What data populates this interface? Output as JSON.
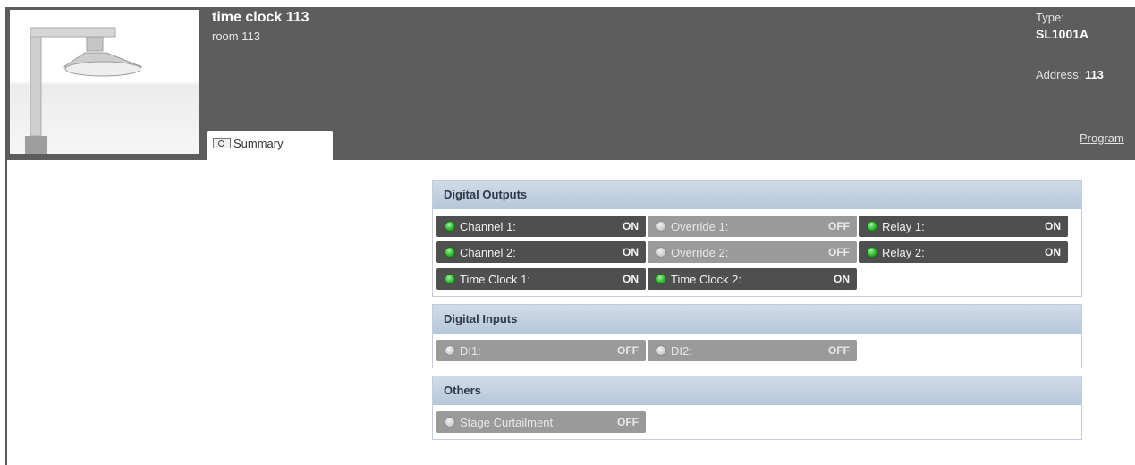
{
  "device": {
    "name": "time clock 113",
    "room": "room 113",
    "type_label": "Type:",
    "type_value": "SL1001A",
    "address_label": "Address:",
    "address_value": "113"
  },
  "tabs": [
    {
      "label": "Summary",
      "icon": "summary-icon"
    }
  ],
  "links": {
    "program": "Program"
  },
  "sections": {
    "digital_outputs": {
      "title": "Digital Outputs",
      "items": [
        {
          "label": "Channel 1:",
          "value": "ON",
          "state": "on"
        },
        {
          "label": "Override 1:",
          "value": "OFF",
          "state": "off"
        },
        {
          "label": "Relay 1:",
          "value": "ON",
          "state": "on"
        },
        {
          "label": "Channel 2:",
          "value": "ON",
          "state": "on"
        },
        {
          "label": "Override 2:",
          "value": "OFF",
          "state": "off"
        },
        {
          "label": "Relay 2:",
          "value": "ON",
          "state": "on"
        },
        {
          "label": "Time Clock 1:",
          "value": "ON",
          "state": "on"
        },
        {
          "label": "Time Clock 2:",
          "value": "ON",
          "state": "on"
        }
      ]
    },
    "digital_inputs": {
      "title": "Digital Inputs",
      "items": [
        {
          "label": "DI1:",
          "value": "OFF",
          "state": "off"
        },
        {
          "label": "DI2:",
          "value": "OFF",
          "state": "off"
        }
      ]
    },
    "others": {
      "title": "Others",
      "items": [
        {
          "label": "Stage Curtailment",
          "value": "OFF",
          "state": "off"
        }
      ]
    }
  },
  "colors": {
    "header_bg": "#5d5d5d",
    "panel_header": "#c3d1e0",
    "led_on": "#2fb92f",
    "cell_on": "#4f4f4f",
    "cell_off": "#9a9a9a"
  }
}
